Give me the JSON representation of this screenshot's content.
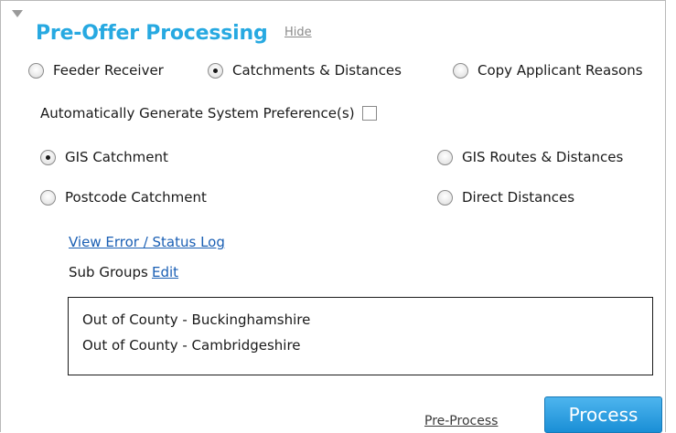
{
  "section": {
    "title": "Pre-Offer Processing",
    "hide_label": "Hide"
  },
  "mode_options": [
    {
      "label": "Feeder Receiver",
      "selected": false
    },
    {
      "label": "Catchments & Distances",
      "selected": true
    },
    {
      "label": "Copy Applicant Reasons",
      "selected": false
    }
  ],
  "auto_generate": {
    "label": "Automatically Generate System Preference(s)",
    "checked": false
  },
  "method_options": [
    {
      "label": "GIS Catchment",
      "selected": true
    },
    {
      "label": "GIS Routes & Distances",
      "selected": false
    },
    {
      "label": "Postcode Catchment",
      "selected": false
    },
    {
      "label": "Direct Distances",
      "selected": false
    }
  ],
  "links": {
    "view_log": "View Error / Status Log",
    "sub_groups_label": "Sub Groups",
    "edit": "Edit"
  },
  "sub_groups": [
    "Out of County - Buckinghamshire",
    "Out of County - Cambridgeshire"
  ],
  "actions": {
    "pre_process": "Pre-Process",
    "process": "Process"
  }
}
